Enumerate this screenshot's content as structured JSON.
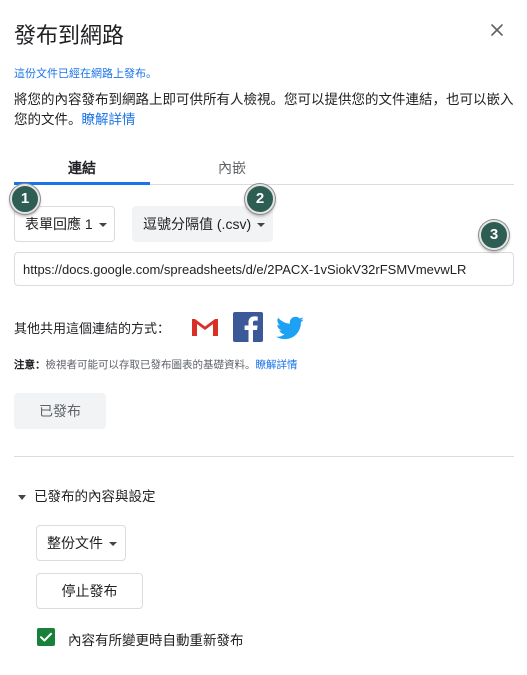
{
  "dialog": {
    "title": "發布到網路",
    "close_icon": "close-icon"
  },
  "published_note": "這份文件已經在網路上發布。",
  "description": {
    "text": "將您的內容發布到網路上即可供所有人檢視。您可以提供您的文件連結，也可以嵌入您的文件。",
    "learn_more": "瞭解詳情"
  },
  "tabs": [
    {
      "label": "連結",
      "selected": true
    },
    {
      "label": "內嵌",
      "selected": false
    }
  ],
  "link": {
    "sheet_select": "表單回應 1",
    "format_select": "逗號分隔值 (.csv)",
    "url": "https://docs.google.com/spreadsheets/d/e/2PACX-1vSiokV32rFSMVmevwLR"
  },
  "badges": [
    "1",
    "2",
    "3"
  ],
  "share": {
    "label": "其他共用這個連結的方式：",
    "icons": [
      "gmail-icon",
      "facebook-icon",
      "twitter-icon"
    ],
    "colors": {
      "gmail": "#d93025",
      "facebook": "#3b5998",
      "twitter": "#1da1f2"
    }
  },
  "notice": {
    "prefix": "注意：",
    "text": "檢視者可能可以存取已發布圖表的基礎資料。",
    "link": "瞭解詳情"
  },
  "published_button": "已發布",
  "published_section": {
    "toggle_label": "已發布的內容與設定",
    "scope_select": "整份文件",
    "stop_button": "停止發布",
    "auto_republish_label": "內容有所變更時自動重新發布",
    "auto_republish_checked": true
  },
  "colors": {
    "accent": "#1a73e8",
    "badge": "#2e5e53",
    "checkbox": "#188038"
  }
}
